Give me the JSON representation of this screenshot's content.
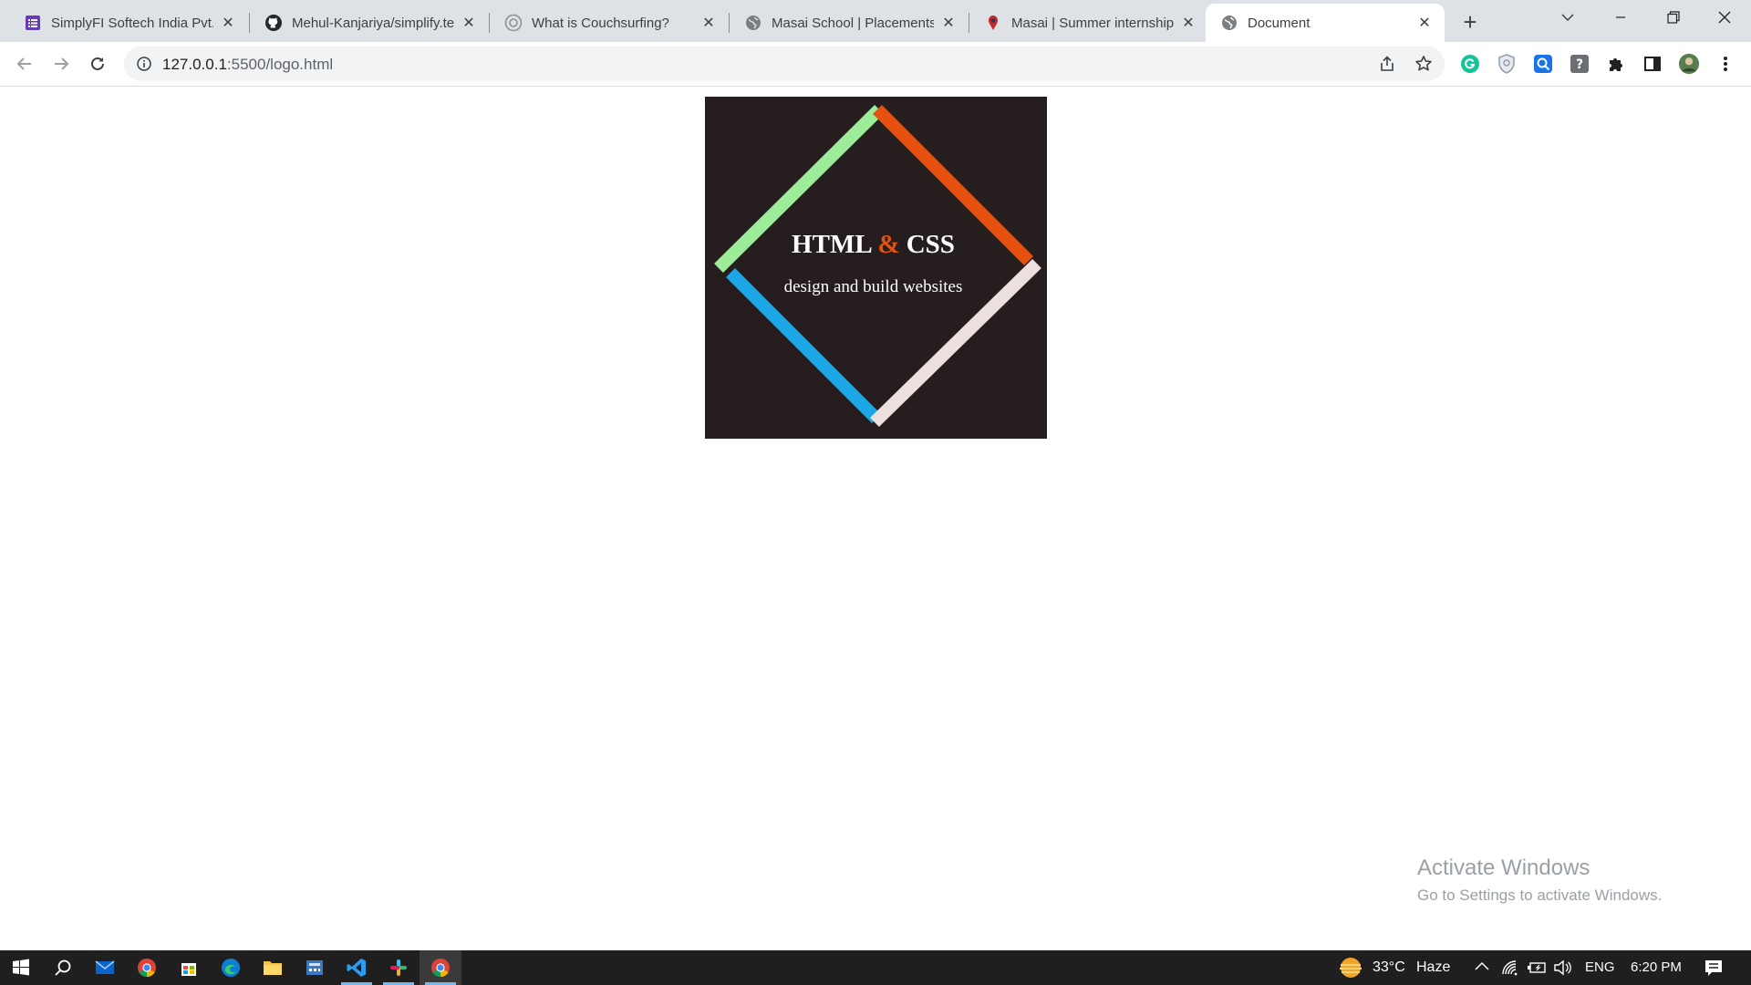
{
  "browser": {
    "tabs": [
      {
        "title": "SimplyFI Softech India Pvt. L",
        "icon": "forms-icon",
        "active": false
      },
      {
        "title": "Mehul-Kanjariya/simplify.te",
        "icon": "github-icon",
        "active": false
      },
      {
        "title": "What is Couchsurfing?",
        "icon": "chatgpt-icon",
        "active": false
      },
      {
        "title": "Masai School | Placements",
        "icon": "globe-icon",
        "active": false
      },
      {
        "title": "Masai | Summer internship",
        "icon": "masai-icon",
        "active": false
      },
      {
        "title": "Document",
        "icon": "globe-icon",
        "active": true
      }
    ],
    "address_host": "127.0.0.1",
    "address_path": ":5500/logo.html"
  },
  "page": {
    "logo": {
      "title_left": "HTML",
      "title_amp": "&",
      "title_right": "CSS",
      "subtitle": "design and build websites",
      "colors": {
        "background": "#261e1e",
        "top_left": "#9cec9a",
        "top_right": "#e8500f",
        "bottom_left": "#1ba7e6",
        "bottom_right": "#ebe0de"
      }
    },
    "watermark": {
      "line1": "Activate Windows",
      "line2": "Go to Settings to activate Windows."
    }
  },
  "taskbar": {
    "weather_temp": "33°C",
    "weather_desc": "Haze",
    "language": "ENG",
    "time": "6:20 PM"
  }
}
